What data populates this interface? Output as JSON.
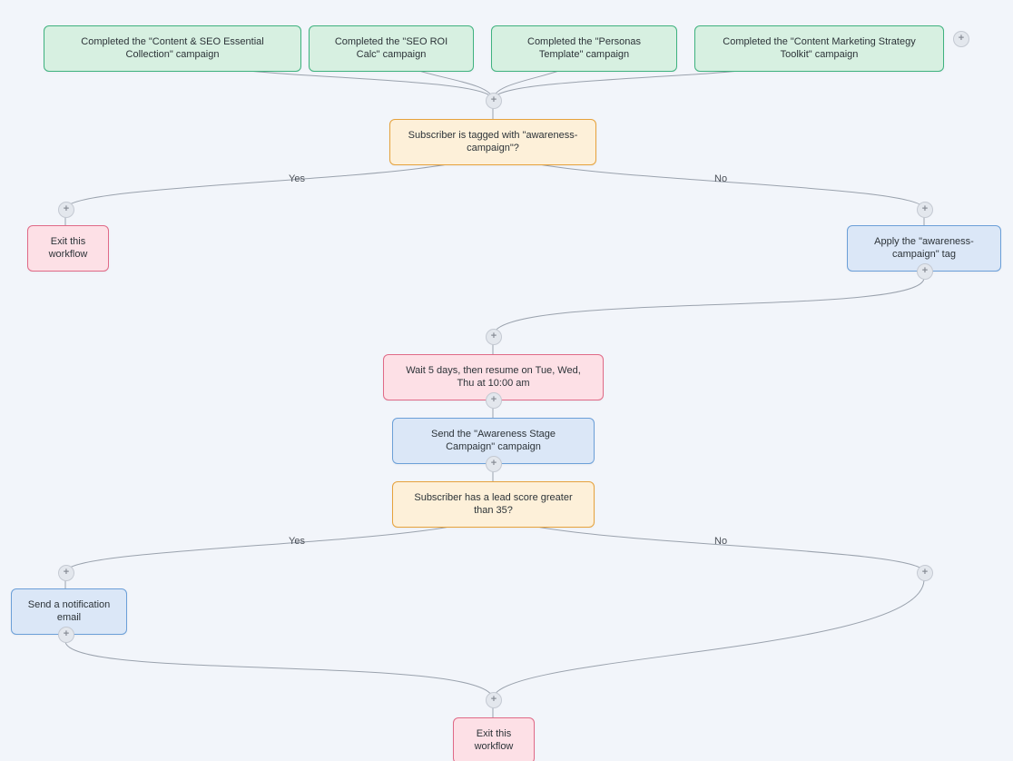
{
  "triggers": {
    "t1": "Completed the \"Content & SEO Essential Collection\" campaign",
    "t2": "Completed the \"SEO ROI Calc\" campaign",
    "t3": "Completed the \"Personas Template\" campaign",
    "t4": "Completed the \"Content Marketing Strategy Toolkit\" campaign"
  },
  "condition1": {
    "label": "Subscriber is tagged with \"awareness-campaign\"?",
    "yes": "Yes",
    "no": "No"
  },
  "exit1": "Exit this workflow",
  "apply_tag": "Apply the \"awareness-campaign\" tag",
  "wait": "Wait 5 days, then resume on Tue, Wed, Thu at 10:00 am",
  "send_campaign": "Send the \"Awareness Stage Campaign\" campaign",
  "condition2": {
    "label": "Subscriber has a lead score greater than 35?",
    "yes": "Yes",
    "no": "No"
  },
  "notify": "Send a notification email",
  "exit2": "Exit this workflow"
}
